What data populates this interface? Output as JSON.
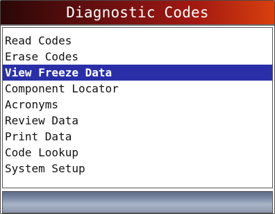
{
  "header": {
    "title": "Diagnostic Codes"
  },
  "menu": {
    "selected_index": 2,
    "items": [
      {
        "label": "Read Codes"
      },
      {
        "label": "Erase Codes"
      },
      {
        "label": "View Freeze Data"
      },
      {
        "label": "Component Locator"
      },
      {
        "label": "Acronyms"
      },
      {
        "label": "Review Data"
      },
      {
        "label": "Print Data"
      },
      {
        "label": "Code Lookup"
      },
      {
        "label": "System Setup"
      }
    ]
  },
  "colors": {
    "title_text": "#ffffff",
    "selection": "#2a2fa8",
    "title_gradient_start": "#2a0707",
    "title_gradient_end": "#d8400e"
  }
}
